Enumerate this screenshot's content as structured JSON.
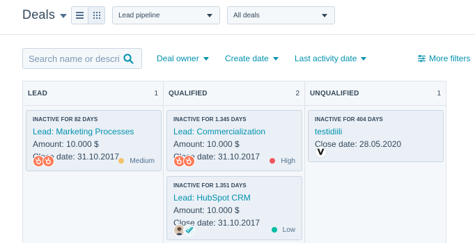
{
  "header": {
    "title": "Deals",
    "pipeline_select": "Lead pipeline",
    "deals_select": "All deals"
  },
  "filters": {
    "search_placeholder": "Search name or descri",
    "deal_owner": "Deal owner",
    "create_date": "Create date",
    "last_activity_date": "Last activity date",
    "more_filters": "More filters"
  },
  "columns": [
    {
      "title": "LEAD",
      "count": "1",
      "cards": [
        {
          "inactive": "INACTIVE FOR 82 DAYS",
          "name": "Lead: Marketing Processes",
          "amount": "Amount: 10.000 $",
          "close": "Close date: 31.10.2017",
          "priority": "Medium",
          "priority_color": "#f5c26b",
          "avatars": [
            "hubspot-avatar-icon",
            "hubspot-avatar-icon"
          ]
        }
      ]
    },
    {
      "title": "QUALIFIED",
      "count": "2",
      "cards": [
        {
          "inactive": "INACTIVE FOR 1.345 DAYS",
          "name": "Lead: Commercialization",
          "amount": "Amount: 10.000 $",
          "close": "Close date: 31.10.2017",
          "priority": "High",
          "priority_color": "#f2545b",
          "avatars": [
            "hubspot-avatar-icon",
            "hubspot-avatar-icon"
          ]
        },
        {
          "inactive": "INACTIVE FOR 1.351 DAYS",
          "name": "Lead: HubSpot CRM",
          "amount": "Amount: 10.000 $",
          "close": "Close date: 31.10.2017",
          "priority": "Low",
          "priority_color": "#00bda5",
          "avatars": [
            "person-avatar-icon",
            "checkmark-avatar-icon"
          ]
        }
      ]
    },
    {
      "title": "UNQUALIFIED",
      "count": "1",
      "cards": [
        {
          "inactive": "INACTIVE FOR 404 DAYS",
          "name": "testidiili",
          "close": "Close date: 28.05.2020",
          "avatars": [
            "v-logo-avatar-icon"
          ]
        }
      ]
    }
  ]
}
